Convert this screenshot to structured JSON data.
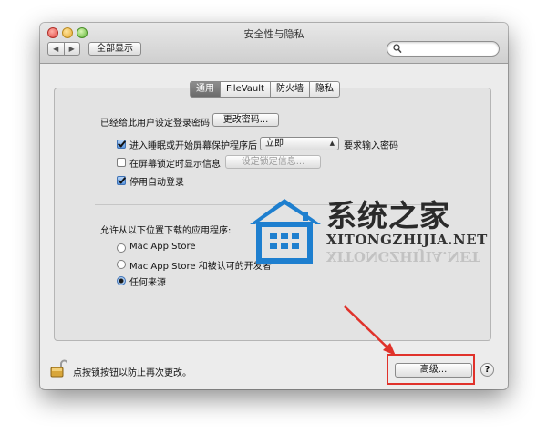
{
  "window": {
    "title": "安全性与隐私"
  },
  "toolbar": {
    "back_label": "◀",
    "forward_label": "▶",
    "show_all_label": "全部显示",
    "search_placeholder": ""
  },
  "tabs": [
    {
      "label": "通用",
      "active": true
    },
    {
      "label": "FileVault",
      "active": false
    },
    {
      "label": "防火墙",
      "active": false
    },
    {
      "label": "隐私",
      "active": false
    }
  ],
  "general": {
    "password_set_label": "已经给此用户设定登录密码",
    "change_password_button": "更改密码...",
    "require_password": {
      "label": "进入睡眠或开始屏幕保护程序后",
      "checked": true,
      "select_value": "立即",
      "suffix": "要求输入密码"
    },
    "show_message": {
      "label": "在屏幕锁定时显示信息",
      "checked": false,
      "button": "设定锁定信息..."
    },
    "disable_autologin": {
      "label": "停用自动登录",
      "checked": true
    },
    "allow_downloads_label": "允许从以下位置下载的应用程序:",
    "options": [
      {
        "label": "Mac App Store",
        "selected": false
      },
      {
        "label": "Mac App Store 和被认可的开发者",
        "selected": false
      },
      {
        "label": "任何来源",
        "selected": true
      }
    ]
  },
  "footer": {
    "lock_text": "点按锁按钮以防止再次更改。",
    "advanced_button": "高级...",
    "help_label": "?"
  },
  "watermark": {
    "title": "系统之家",
    "subtitle": "XITONGZHIJIA.NET"
  },
  "colors": {
    "highlight": "#e0322b",
    "accent": "#5a96e0"
  }
}
